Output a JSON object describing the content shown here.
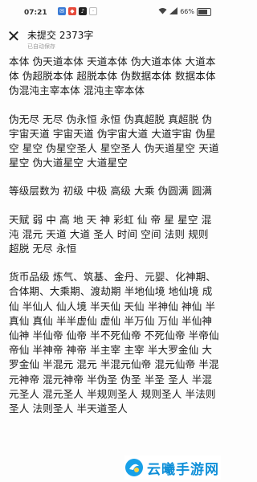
{
  "status_bar": {
    "time": "07:21",
    "battery": "66%",
    "battery_level": 0.66
  },
  "header": {
    "title": "未提交 2373字",
    "subtitle": "已自动保存"
  },
  "content": {
    "paragraphs": [
      "本体 伪天道本体 天道本体 伪大道本体 大道本体 伪超脱本体 超脱本体 伪数据本体 数据本体 伪混沌主宰本体 混沌主宰本体",
      "伪无尽 无尽 伪永恒 永恒 伪真超脱 真超脱 伪宇宙天道 宇宙天道 伪宇宙大道 大道宇宙 伪星空 星空 伪星空圣人 星空圣人 伪天道星空 天道星空 伪大道星空 大道星空",
      "等级层数为 初级 中极 高级 大乘 伪圆满 圆满",
      "天赋 弱 中 高 地 天 神 彩虹 仙 帝 星 星空 混沌 混元 天道 大道 圣人 时间 空间 法则 规则 超脱 无尽 永恒",
      "货币品级 炼气、筑基、金丹、元婴、化神期、合体期、大乘期、渡劫期 半地仙境 地仙境 成仙 半仙人 仙人境 半天仙 天仙 半神仙 神仙 半真仙 真仙 半半虚仙 虚仙 半万仙 万仙 半仙神 仙神 半仙帝 仙帝 半不死仙帝 不死仙帝 半帝仙 帝仙 半神帝 神帝 半主宰 主宰 半大罗金仙 大罗金仙 半混元 混元 半混元仙帝 混元仙帝 半混元神帝 混元神帝 半伪圣 伪圣 半圣 圣人 半混元圣人 混元圣人 半规则圣人 规则圣人 半法则圣人 法则圣人 半天道圣人"
    ]
  },
  "watermark": {
    "text": "云曦手游网"
  }
}
